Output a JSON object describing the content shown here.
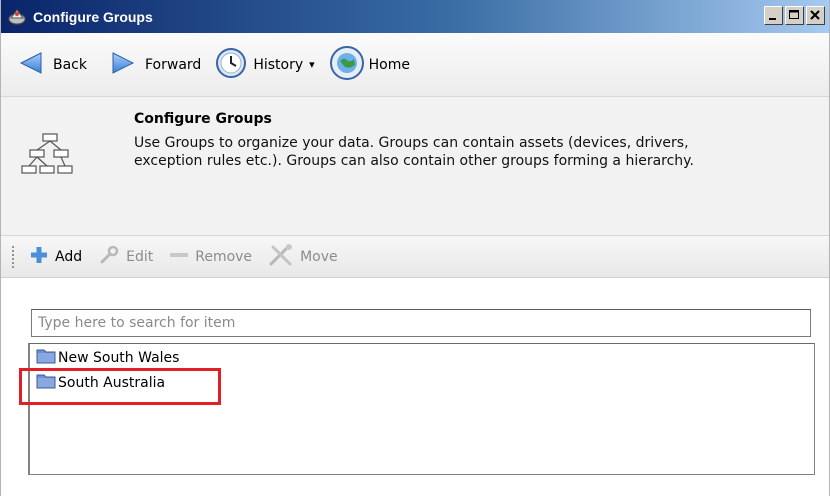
{
  "window": {
    "title": "Configure Groups",
    "controls": {
      "minimize": "_",
      "maximize": "□",
      "close": "×"
    }
  },
  "nav": {
    "back_label": "Back",
    "forward_label": "Forward",
    "history_label": "History",
    "history_caret": "▾",
    "home_label": "Home"
  },
  "header": {
    "title": "Configure Groups",
    "description": "Use Groups to organize your data. Groups can contain assets (devices, drivers, exception rules etc.). Groups can also contain other groups forming a hierarchy."
  },
  "toolbar": {
    "add_label": "Add",
    "edit_label": "Edit",
    "remove_label": "Remove",
    "move_label": "Move"
  },
  "search": {
    "placeholder": "Type here to search for item",
    "value": ""
  },
  "groups": [
    {
      "label": "New South Wales"
    },
    {
      "label": "South Australia",
      "highlighted": true
    }
  ],
  "colors": {
    "highlight": "#e21e26",
    "titlebar_start": "#0a246a",
    "titlebar_end": "#a6caf0"
  }
}
